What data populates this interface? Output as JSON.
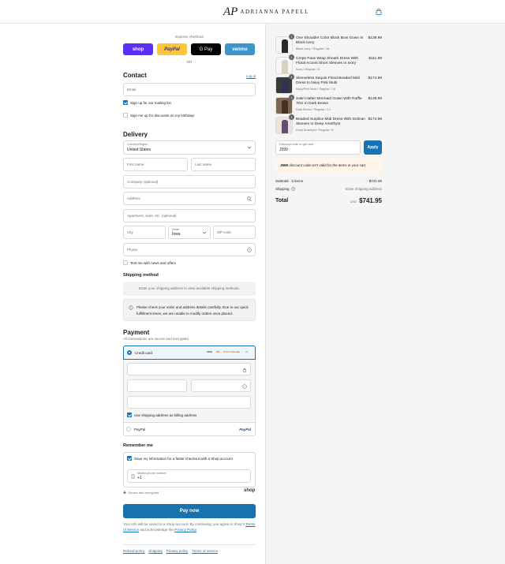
{
  "brand": {
    "mark": "AP",
    "name": "ADRIANNA PAPELL"
  },
  "express": {
    "title": "Express checkout",
    "buttons": [
      {
        "label": "shop",
        "bg": "#5a31f4",
        "fg": "#ffffff"
      },
      {
        "label": "PayPal",
        "bg": "#ffc439",
        "fg": "#253b80"
      },
      {
        "label": "G Pay",
        "bg": "#000000",
        "fg": "#ffffff"
      },
      {
        "label": "venmo",
        "bg": "#3d95ce",
        "fg": "#ffffff"
      }
    ],
    "or": "OR"
  },
  "contact": {
    "title": "Contact",
    "login": "Log in",
    "email_placeholder": "Email",
    "mailing_label": "Sign up for our mailing list",
    "birthday_label": "Sign me up for discounts on my birthday!"
  },
  "delivery": {
    "title": "Delivery",
    "country_label": "Country/Region",
    "country_value": "United States",
    "first_name": "First name",
    "last_name": "Last name",
    "company": "Company (optional)",
    "address": "Address",
    "apartment": "Apartment, suite, etc. (optional)",
    "city": "City",
    "state_label": "State",
    "state_value": "Iowa",
    "zip": "ZIP code",
    "phone": "Phone",
    "text_me": "Text me with news and offers"
  },
  "shipping_method": {
    "title": "Shipping method",
    "placeholder": "Enter your shipping address to view available shipping methods.",
    "notice": "Please check your order and address details carefully. Due to our quick fulfillment times, we are unable to modify orders once placed."
  },
  "payment": {
    "title": "Payment",
    "subtitle": "All transactions are secure and encrypted.",
    "credit_card": "Credit card",
    "card_brands": [
      "VISA",
      "MC",
      "DISCOVER",
      "elo",
      "+5"
    ],
    "billing_label": "Use shipping address as billing address",
    "paypal": "PayPal",
    "paypal_logo": "PayPal"
  },
  "remember": {
    "title": "Remember me",
    "save_label": "Save my information for a faster checkout with a Shop account",
    "phone_label": "Mobile phone number",
    "phone_value": "+1",
    "secure": "Secure and encrypted",
    "shop": "shop"
  },
  "pay_now": "Pay now",
  "disclaimer": {
    "text1": "Your info will be saved to a Shop account. By continuing, you agree to Shop's",
    "tos": "Terms of Service",
    "and": "and acknowledge the",
    "privacy": "Privacy Policy",
    "end": "."
  },
  "footer_links": [
    "Refund policy",
    "Shipping",
    "Privacy policy",
    "Terms of service"
  ],
  "order": {
    "items": [
      {
        "qty": "1",
        "name": "One Shoulder Color Block Bow Gown In Black Ivory",
        "variant": "Black Ivory / Regular / 16",
        "price": "$139.99",
        "color": "#2a2a2a"
      },
      {
        "qty": "1",
        "name": "Crepe Faux Wrap Sheath Dress With Floral Accent Short Sleeves In Ivory",
        "variant": "Ivory / Regular / 8",
        "price": "$111.99",
        "color": "#e8e2d6"
      },
      {
        "qty": "1",
        "name": "Sleeveless Sequin Floral Beaded Midi Dress In Navy Pink Multi",
        "variant": "Navy/Pink Multi / Regular / 16",
        "price": "$174.99",
        "color": "#2b3350"
      },
      {
        "qty": "1",
        "name": "Satin Halter Mermaid Gown With Ruffle Trim In Dark Brown",
        "variant": "Dark Brown / Regular / 14",
        "price": "$139.99",
        "color": "#5a3a28"
      },
      {
        "qty": "1",
        "name": "Beaded Surplice Midi Dress With Dolman Sleeves In Deep Amethyst",
        "variant": "Deep Amethyst / Regular / 6",
        "price": "$174.99",
        "color": "#6b4a72"
      }
    ],
    "discount_label": "Discount code or gift card",
    "discount_value": "J599",
    "apply": "Apply",
    "warning_code": "J599",
    "warning_text": "discount code isn't valid for the items in your cart",
    "subtotal_label": "Subtotal · 5 items",
    "subtotal": "$741.95",
    "shipping_label": "Shipping",
    "shipping_value": "Enter shipping address",
    "total_label": "Total",
    "currency": "USD",
    "total": "$741.95"
  },
  "colors": {
    "accent": "#1773b0",
    "warning_bg": "#fff5ea"
  }
}
